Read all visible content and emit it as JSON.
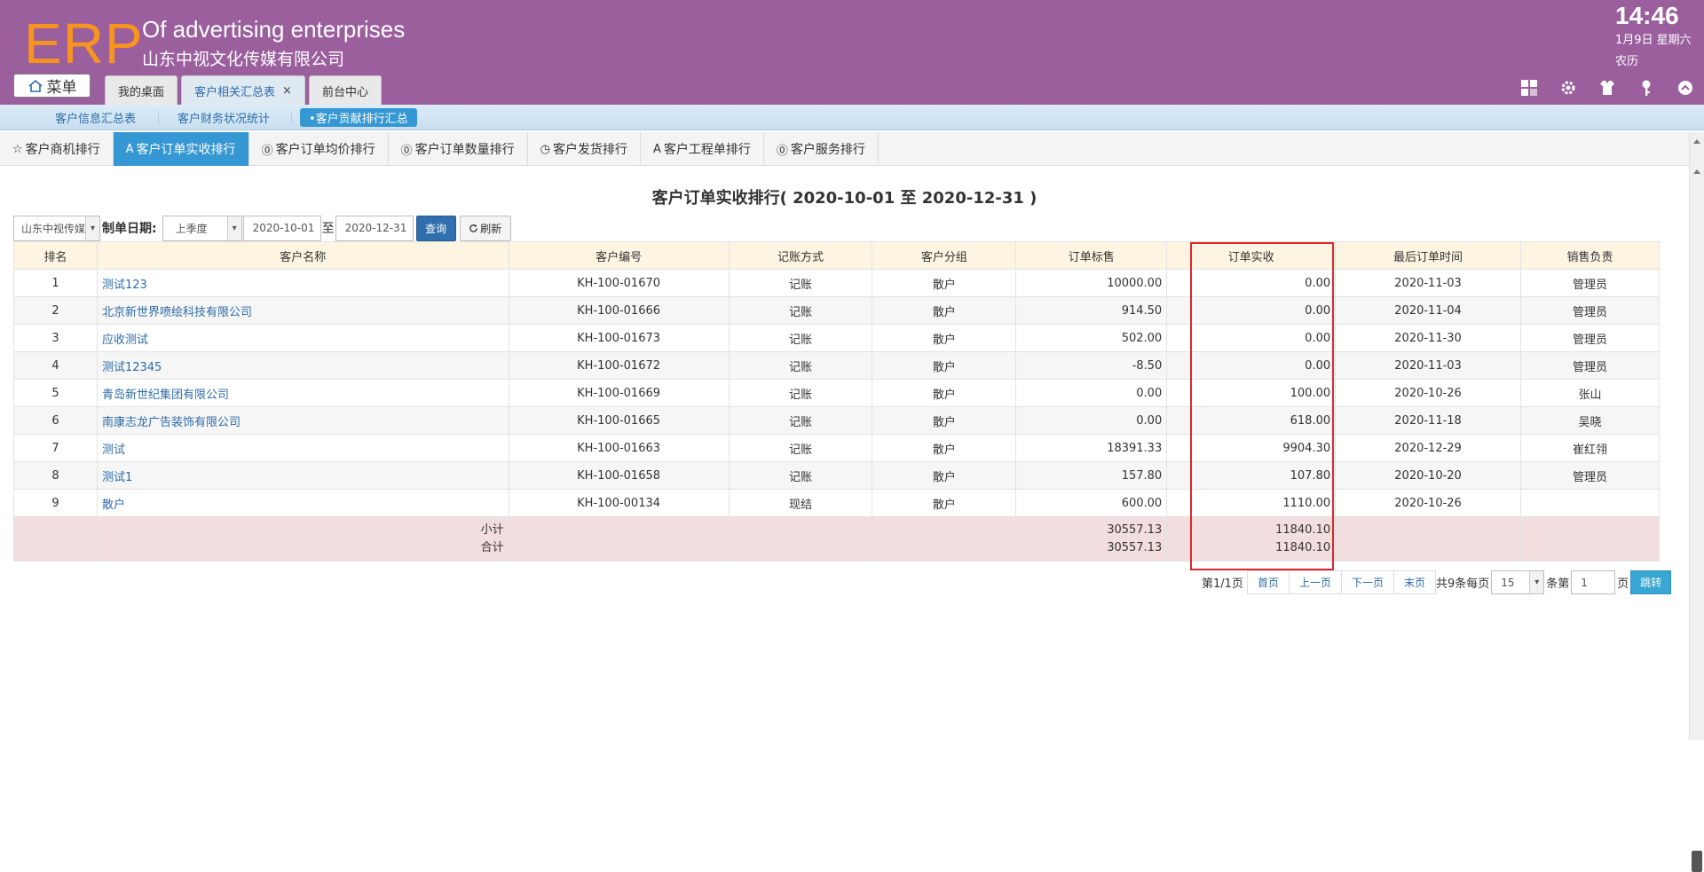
{
  "header": {
    "logo": "ERP",
    "company_en": "Of advertising enterprises",
    "company_cn": "山东中视文化传媒有限公司",
    "time": "14:46",
    "date": "1月9日 星期六",
    "lunar": "农历",
    "menu_label": "菜单",
    "tabs": [
      {
        "label": "我的桌面"
      },
      {
        "label": "客户相关汇总表",
        "active": true,
        "closable": true,
        "close": "×"
      },
      {
        "label": "前台中心"
      }
    ],
    "icons": [
      "grid-icon",
      "gear-icon",
      "shirt-icon",
      "key-icon",
      "collapse-icon"
    ]
  },
  "subnav": {
    "items": [
      {
        "label": "客户信息汇总表"
      },
      {
        "label": "客户财务状况统计"
      },
      {
        "label": "•客户贡献排行汇总",
        "active": true
      }
    ]
  },
  "rank_tabs": [
    {
      "icon": "☆",
      "label": "客户商机排行"
    },
    {
      "icon": "A",
      "label": "客户订单实收排行",
      "active": true
    },
    {
      "icon": "⓪",
      "label": "客户订单均价排行"
    },
    {
      "icon": "⓪",
      "label": "客户订单数量排行"
    },
    {
      "icon": "◷",
      "label": "客户发货排行"
    },
    {
      "icon": "A",
      "label": "客户工程单排行"
    },
    {
      "icon": "⓪",
      "label": "客户服务排行"
    }
  ],
  "report": {
    "title": "客户订单实收排行( 2020-10-01 至 2020-12-31 )"
  },
  "filter": {
    "company": "山东中视传媒",
    "date_label": "制单日期:",
    "period": "上季度",
    "start": "2020-10-01",
    "to": "至",
    "end": "2020-12-31",
    "query": "查询",
    "refresh": "刷新"
  },
  "table": {
    "columns": [
      "排名",
      "客户名称",
      "客户编号",
      "记账方式",
      "客户分组",
      "订单标售",
      "订单实收",
      "最后订单时间",
      "销售负责"
    ],
    "rows": [
      [
        "1",
        "测试123",
        "KH-100-01670",
        "记账",
        "散户",
        "10000.00",
        "0.00",
        "2020-11-03",
        "管理员"
      ],
      [
        "2",
        "北京新世界喷绘科技有限公司",
        "KH-100-01666",
        "记账",
        "散户",
        "914.50",
        "0.00",
        "2020-11-04",
        "管理员"
      ],
      [
        "3",
        "应收测试",
        "KH-100-01673",
        "记账",
        "散户",
        "502.00",
        "0.00",
        "2020-11-30",
        "管理员"
      ],
      [
        "4",
        "测试12345",
        "KH-100-01672",
        "记账",
        "散户",
        "-8.50",
        "0.00",
        "2020-11-03",
        "管理员"
      ],
      [
        "5",
        "青岛新世纪集团有限公司",
        "KH-100-01669",
        "记账",
        "散户",
        "0.00",
        "100.00",
        "2020-10-26",
        "张山"
      ],
      [
        "6",
        "南康志龙广告装饰有限公司",
        "KH-100-01665",
        "记账",
        "散户",
        "0.00",
        "618.00",
        "2020-11-18",
        "吴晓"
      ],
      [
        "7",
        "测试",
        "KH-100-01663",
        "记账",
        "散户",
        "18391.33",
        "9904.30",
        "2020-12-29",
        "崔红翎"
      ],
      [
        "8",
        "测试1",
        "KH-100-01658",
        "记账",
        "散户",
        "157.80",
        "107.80",
        "2020-10-20",
        "管理员"
      ],
      [
        "9",
        "散户",
        "KH-100-00134",
        "现结",
        "散户",
        "600.00",
        "1110.00",
        "2020-10-26",
        ""
      ]
    ],
    "subtotal_label": "小计",
    "total_label": "合计",
    "subtotal_sales": "30557.13",
    "subtotal_received": "11840.10",
    "total_sales": "30557.13",
    "total_received": "11840.10"
  },
  "pager": {
    "page_info": "第1/1页",
    "first": "首页",
    "prev": "上一页",
    "next": "下一页",
    "last": "末页",
    "count_text": "共9条每页",
    "page_size": "15",
    "per_unit": "条第",
    "page_input": "1",
    "page_unit": "页",
    "go": "跳转"
  }
}
